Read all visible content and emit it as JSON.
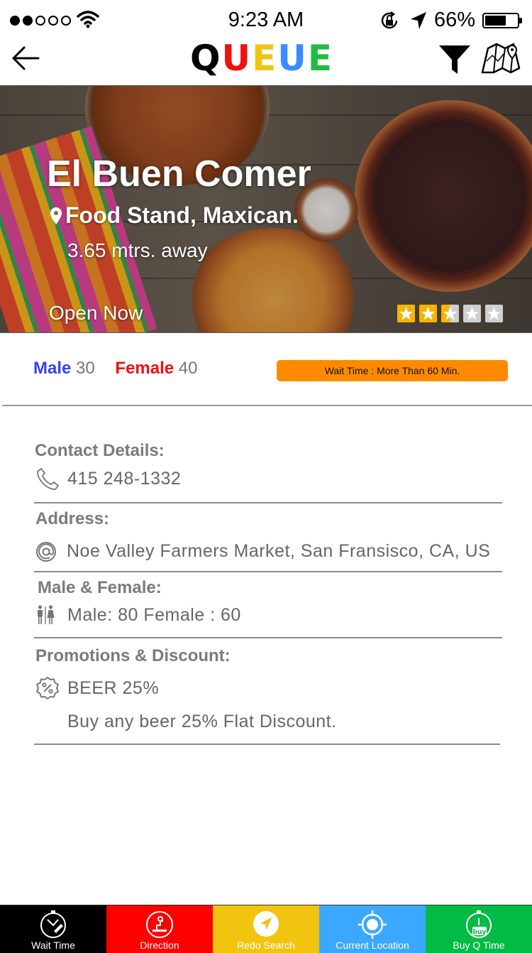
{
  "status_bar": {
    "time": "9:23 AM",
    "battery": "66%",
    "battery_level": 0.66,
    "signal_dots_filled": 2,
    "signal_dots_total": 5
  },
  "nav": {
    "logo_letters": [
      "Q",
      "U",
      "E",
      "U",
      "E"
    ],
    "logo_colors": [
      "#000000",
      "#ee1111",
      "#f1c40f",
      "#3a8bff",
      "#22bb44"
    ],
    "back_icon": "arrow-left-icon",
    "filter_icon": "filter-icon",
    "map_icon": "map-icon"
  },
  "venue": {
    "name": "El Buen Comer",
    "type": "Food Stand, Maxican.",
    "distance": "3.65 mtrs. away",
    "status": "Open Now",
    "rating": 2.5,
    "rating_max": 5
  },
  "crowd": {
    "male_label": "Male",
    "male_count": "30",
    "female_label": "Female",
    "female_count": "40",
    "wait_time": "Wait Time : More Than 60 Min."
  },
  "details": {
    "contact_title": "Contact Details:",
    "phone": "415 248-1332",
    "address_title": "Address:",
    "address": "Noe Valley Farmers Market, San Fransisco, CA, US",
    "gender_title": "Male & Female:",
    "gender_counts": "Male: 80 Female : 60",
    "promo_title": "Promotions & Discount:",
    "promo_name": "BEER 25%",
    "promo_desc": "Buy any beer 25% Flat Discount."
  },
  "tabs": [
    {
      "label": "Wait Time",
      "color": "#000000",
      "icon": "stopwatch-icon"
    },
    {
      "label": "Direction",
      "color": "#ff0000",
      "icon": "direction-icon"
    },
    {
      "label": "Redo Search",
      "color": "#f1c40f",
      "icon": "navigation-arrow-icon"
    },
    {
      "label": "Current Location",
      "color": "#3aa8ff",
      "icon": "crosshair-icon"
    },
    {
      "label": "Buy Q Time",
      "color": "#00bb44",
      "icon": "buy-timer-icon"
    }
  ],
  "colors": {
    "accent_orange": "#ff8a00",
    "male_blue": "#3344ee",
    "female_red": "#ee1111",
    "star_gold": "#f5b400"
  }
}
